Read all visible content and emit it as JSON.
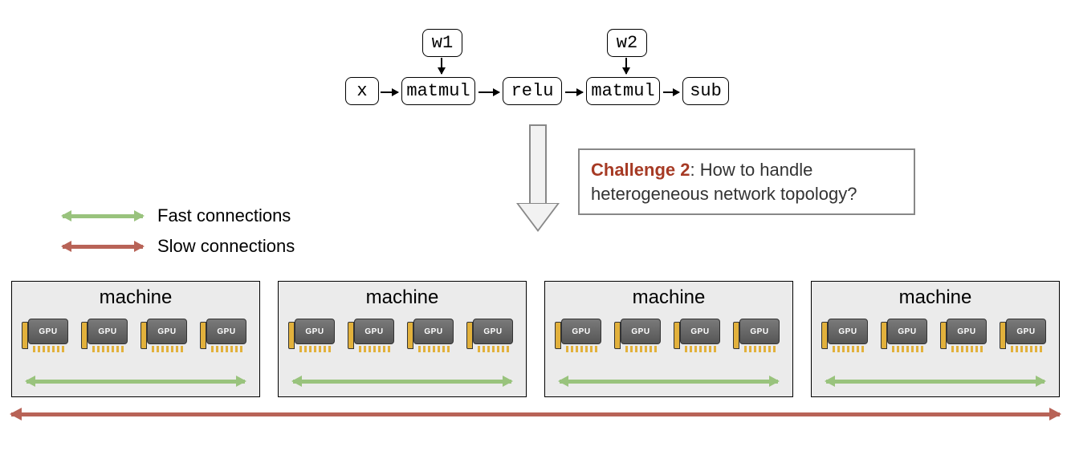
{
  "graph": {
    "x": "x",
    "w1": "w1",
    "w2": "w2",
    "matmul1": "matmul",
    "relu": "relu",
    "matmul2": "matmul",
    "sub": "sub"
  },
  "challenge": {
    "title": "Challenge 2",
    "body": ": How to handle heterogeneous network topology?"
  },
  "legend": {
    "fast": "Fast connections",
    "slow": "Slow connections"
  },
  "machine_label": "machine",
  "gpu_label": "GPU",
  "machine_count": 4,
  "gpus_per_machine": 4,
  "colors": {
    "fast": "#99c37d",
    "slow": "#b86357",
    "challenge_title": "#a63a24",
    "machine_bg": "#ebebeb"
  }
}
